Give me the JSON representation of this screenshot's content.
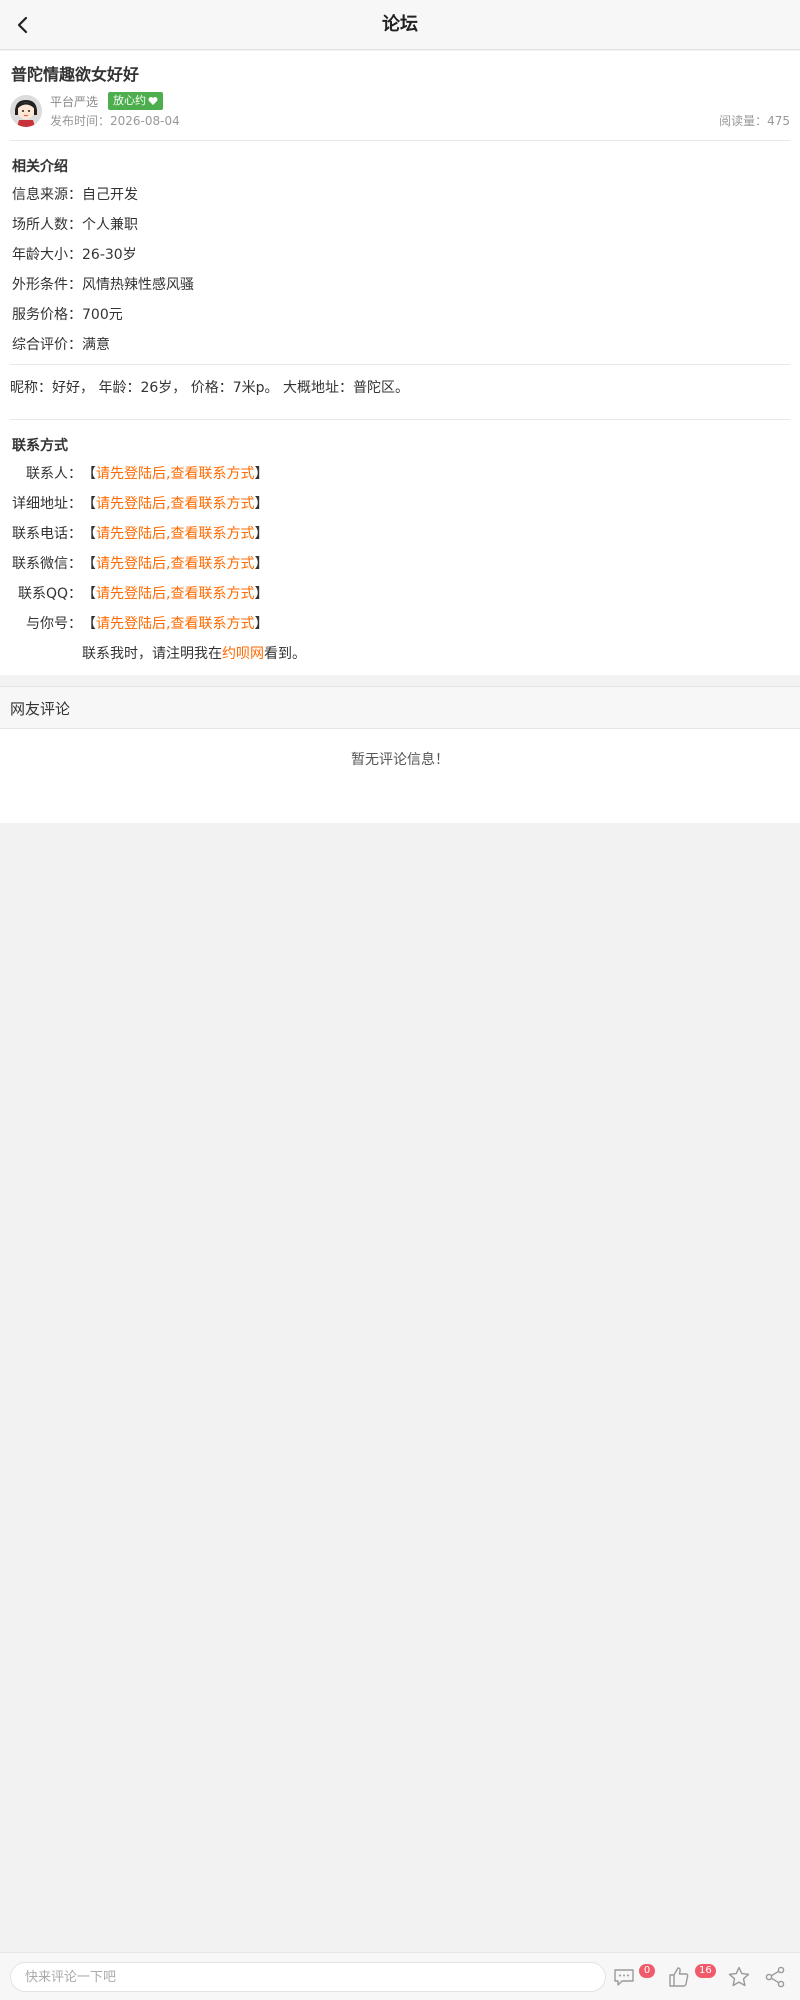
{
  "header": {
    "title": "论坛"
  },
  "post": {
    "title": "普陀情趣欲女好好",
    "author": "平台严选",
    "badge": "放心约",
    "publish_time": "发布时间：2026-08-04",
    "reads": "阅读量：475"
  },
  "intro": {
    "heading": "相关介绍",
    "rows": [
      "信息来源：自己开发",
      "场所人数：个人兼职",
      "年龄大小：26-30岁",
      "外形条件：风情热辣性感风骚",
      "服务价格：700元",
      "综合评价：满意"
    ]
  },
  "description": "昵称：好好， 年龄：26岁， 价格：7米p。 大概地址：普陀区。",
  "contact": {
    "heading": "联系方式",
    "bracket_open": "【",
    "bracket_close": "】",
    "login_text": "请先登陆后,查看联系方式",
    "labels": [
      "联系人：",
      "详细地址：",
      "联系电话：",
      "联系微信：",
      "联系QQ：",
      "与你号："
    ],
    "note_prefix": "联系我时，请注明我在",
    "note_link": "约呗网",
    "note_suffix": "看到。"
  },
  "comments": {
    "title": "网友评论",
    "empty": "暂无评论信息！"
  },
  "bottom_bar": {
    "placeholder": "快来评论一下吧",
    "comment_count": "0",
    "like_count": "16"
  },
  "colors": {
    "accent": "#ff6a00",
    "badge_green": "#4cae4c",
    "count_red": "#f05a6a"
  }
}
